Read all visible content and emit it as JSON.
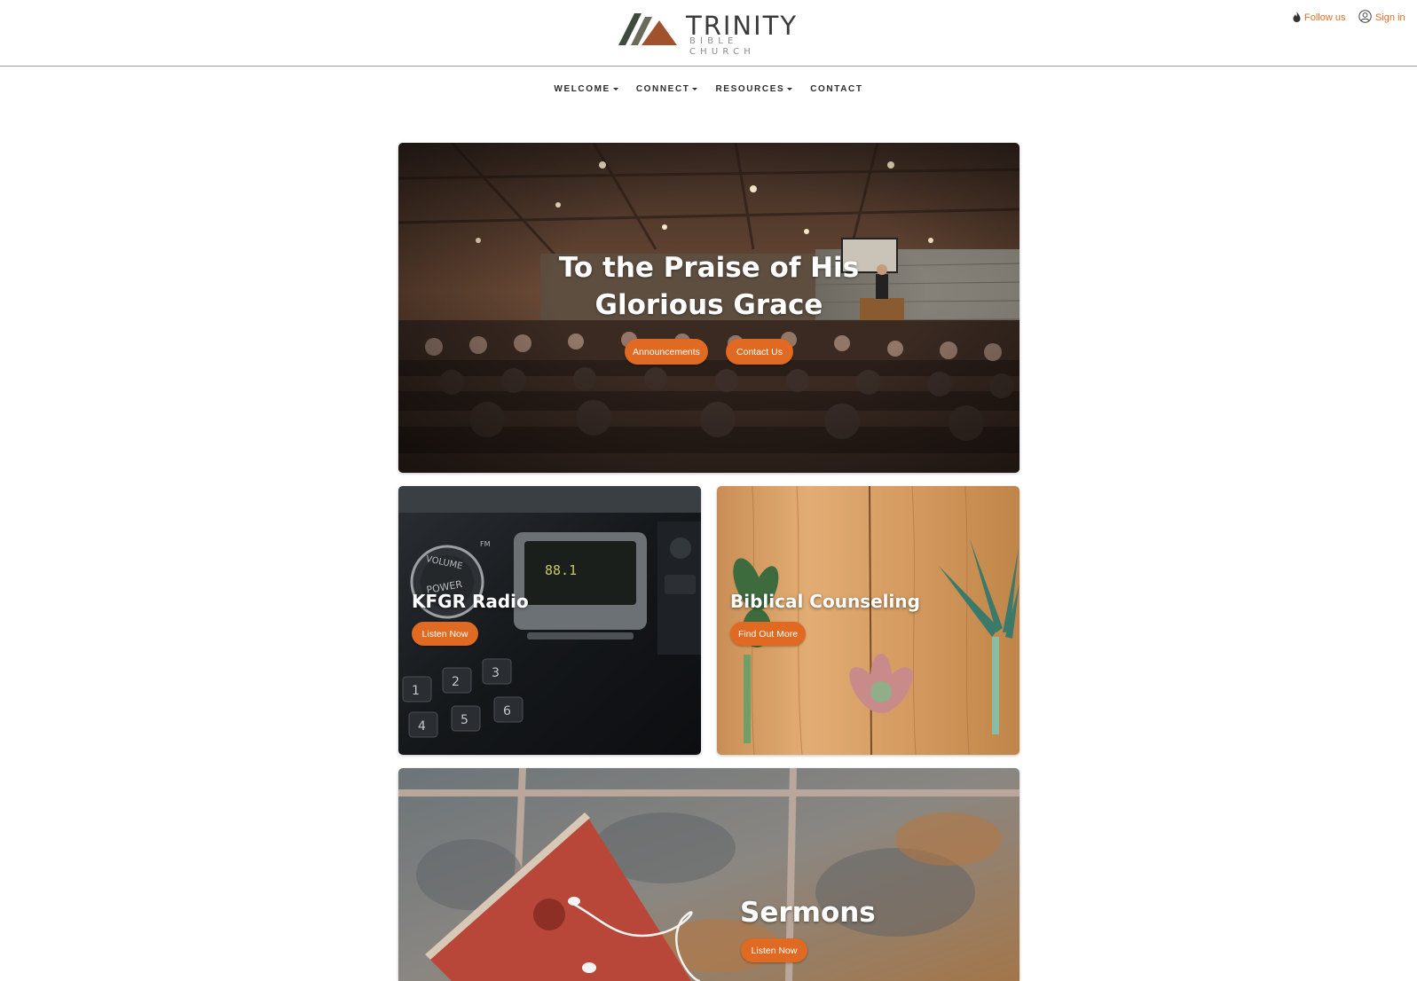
{
  "header": {
    "logo_title": "TRINITY",
    "logo_subtitle": "BIBLE CHURCH",
    "follow_label": "Follow us",
    "signin_label": "Sign in"
  },
  "nav": {
    "items": [
      {
        "label": "WELCOME",
        "dropdown": true
      },
      {
        "label": "CONNECT",
        "dropdown": true
      },
      {
        "label": "RESOURCES",
        "dropdown": true
      },
      {
        "label": "CONTACT",
        "dropdown": false
      }
    ]
  },
  "hero": {
    "title": "To the Praise of His Glorious Grace",
    "buttons": [
      "Announcements",
      "Contact Us"
    ]
  },
  "radio": {
    "title": "KFGR Radio",
    "button": "Listen Now",
    "display_text": "88.1",
    "knob_top": "VOLUME",
    "knob_bottom": "POWER",
    "band_label": "FM"
  },
  "counseling": {
    "title": "Biblical Counseling",
    "button": "Find Out More"
  },
  "sermons": {
    "title": "Sermons",
    "button": "Listen Now"
  },
  "colors": {
    "accent": "#e06a22",
    "link": "#e07028",
    "logo_dark": "#3f4a3f",
    "logo_brown": "#a0522d"
  },
  "icons": [
    "follow-icon",
    "user-icon",
    "caret-down-icon"
  ]
}
